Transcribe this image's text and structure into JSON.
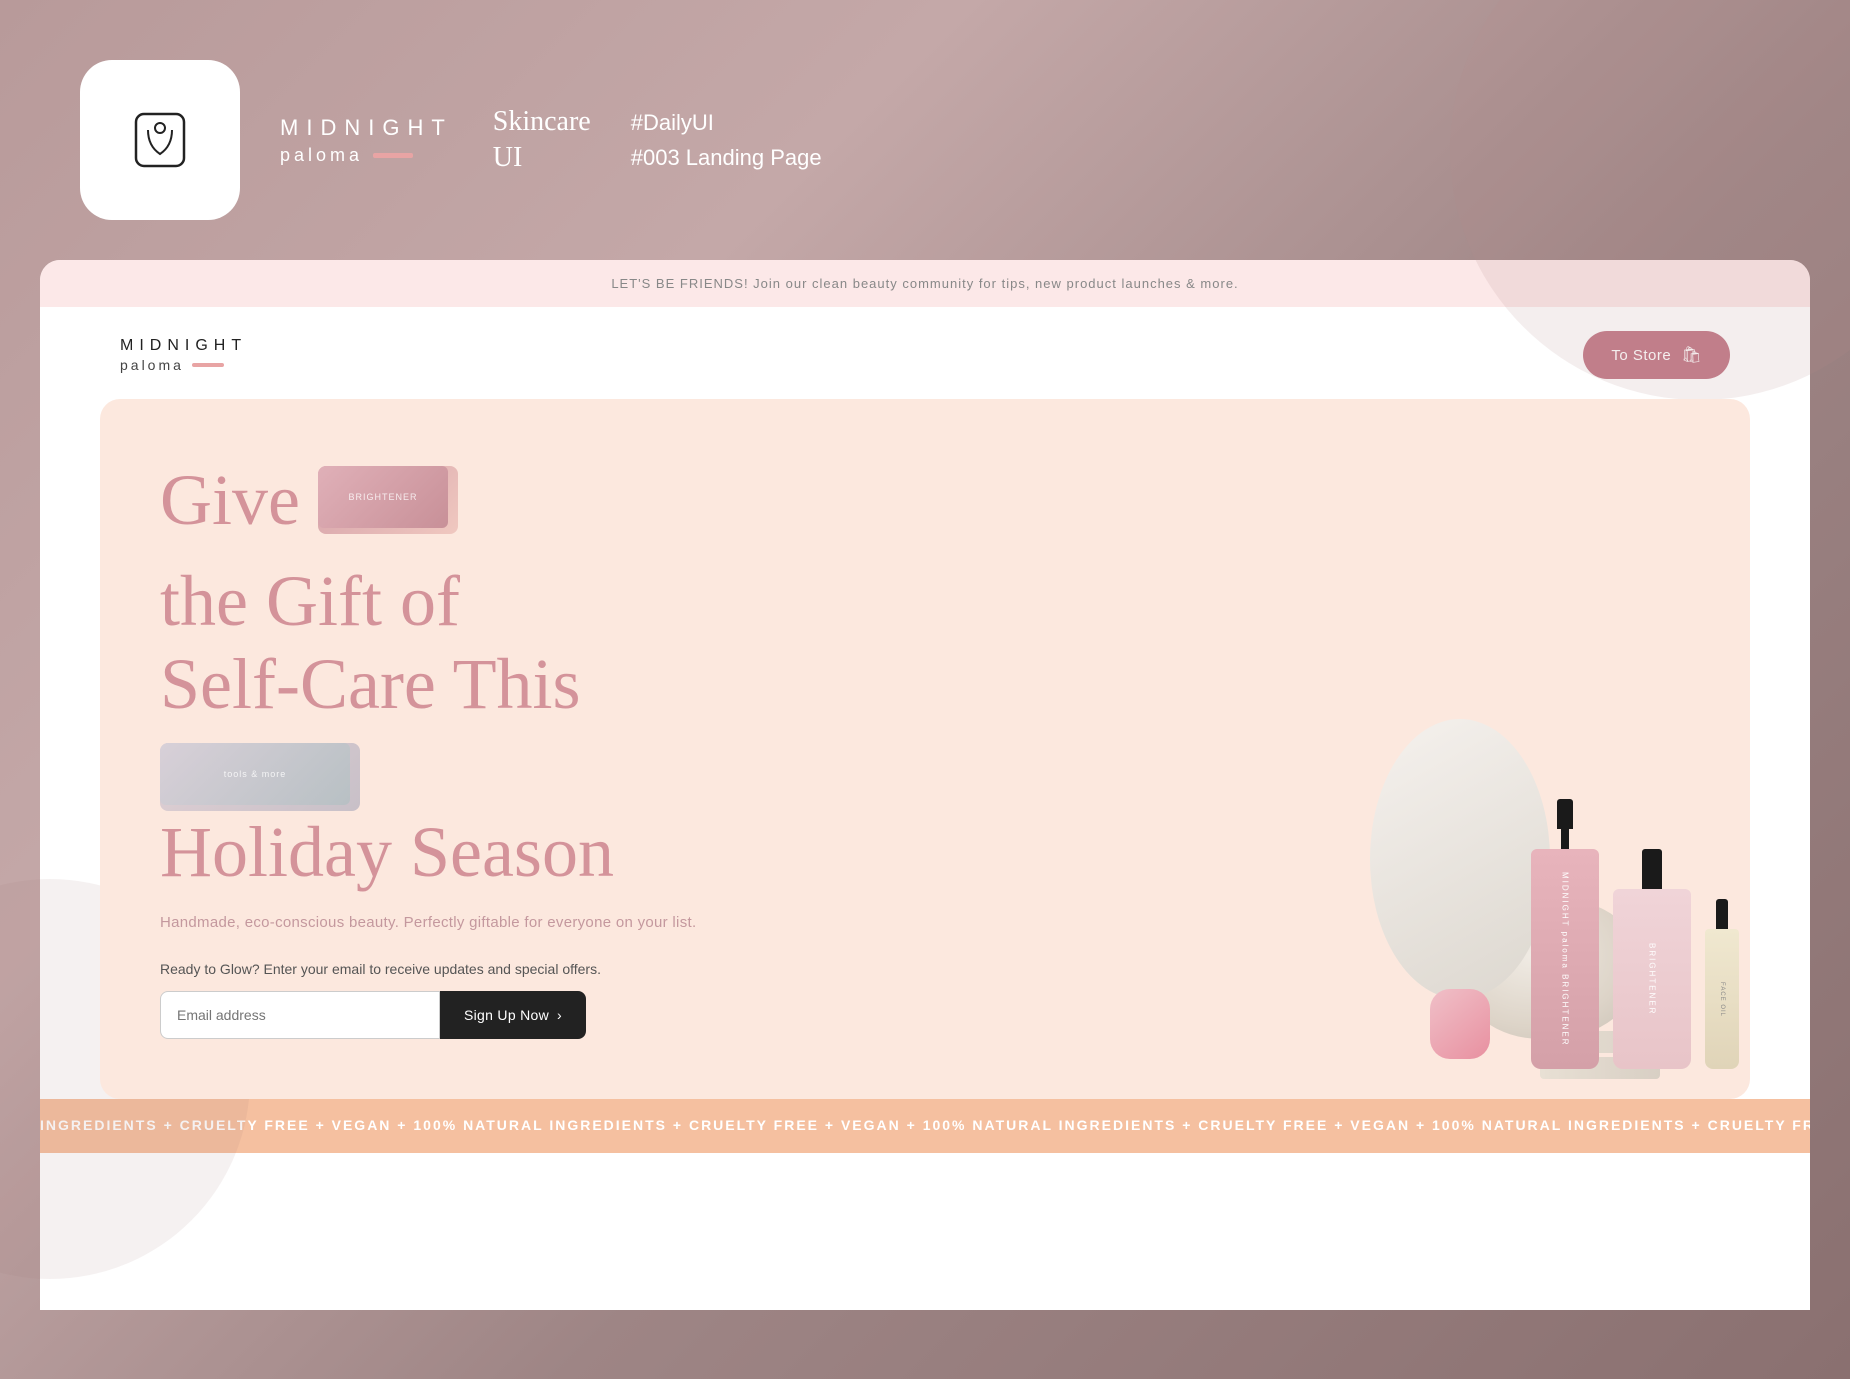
{
  "meta": {
    "brand_name": "MIDNIGHT",
    "brand_sub": "paloma",
    "section1": "Skincare",
    "section2": "UI",
    "daily_ui": "#DailyUI",
    "challenge_num": "#003 Landing Page"
  },
  "announcement": {
    "text": "LET'S BE FRIENDS! Join our clean beauty community for tips, new product launches & more."
  },
  "nav": {
    "logo_name": "MIDNIGHT",
    "logo_sub": "paloma",
    "to_store_label": "To Store"
  },
  "hero": {
    "headline_part1": "Give",
    "headline_part2": "the Gift of",
    "headline_part3": "Self-Care This",
    "headline_part4": "Holiday Season",
    "inset_label1": "BRIGHTENER",
    "inset_label2": "tools & more",
    "sub": "Handmade, eco-conscious beauty. Perfectly giftable for everyone on your list.",
    "cta_label": "Ready to Glow? Enter your email to receive updates and special offers.",
    "email_placeholder": "Email address",
    "signup_label": "Sign Up Now",
    "signup_arrow": "›"
  },
  "ticker": {
    "text": "INGREDIENTS + CRUELTY FREE + VEGAN + 100% NATURAL INGREDIENTS + CRUELTY FREE + VEGAN + 100% NATURAL INGREDIENTS + CRUELTY FREE + VEGAN + 100% NATURAL "
  },
  "products": {
    "bottle1_label": "MIDNIGHT paloma BRIGHTENER",
    "bottle2_label": "BRIGHTENER",
    "roller_label": "FACE OIL"
  },
  "colors": {
    "pink_accent": "#c47c8a",
    "hero_bg": "#fce8de",
    "ticker_bg": "#f5c0a0",
    "announcement_bg": "#fce8e8",
    "headline_color": "#d4939a",
    "dark": "#222222"
  }
}
